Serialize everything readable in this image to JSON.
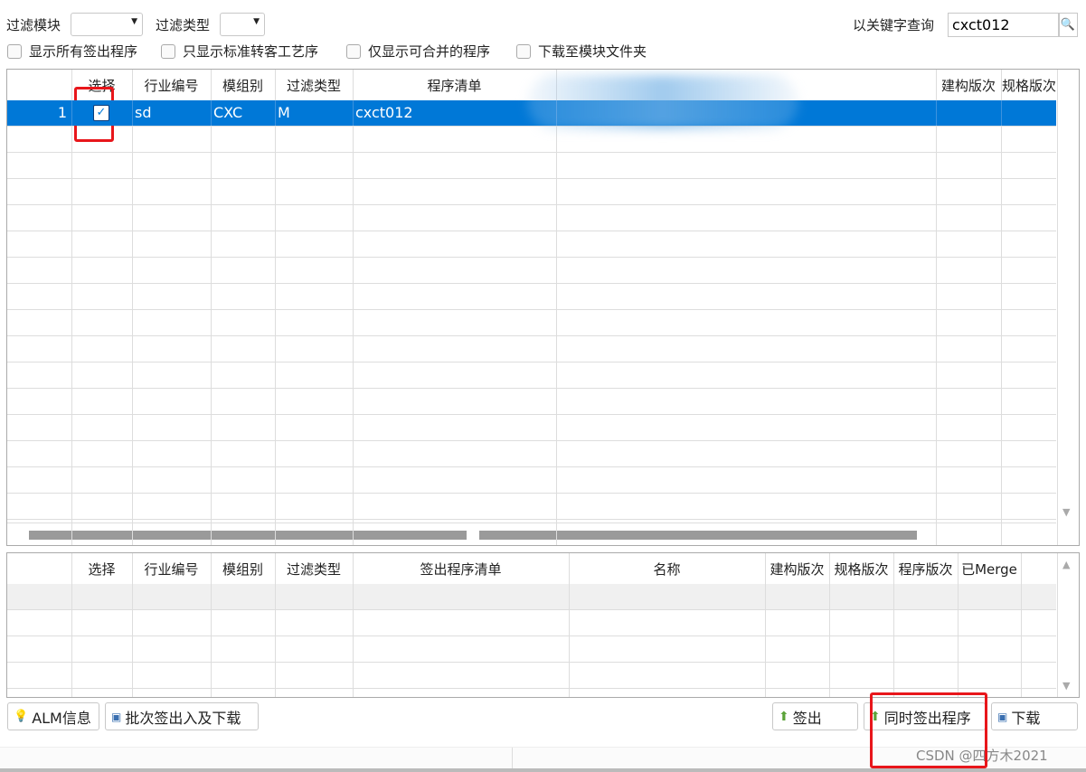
{
  "filters": {
    "module_label": "过滤模块",
    "module_value": "",
    "type_label": "过滤类型",
    "type_value": "",
    "search_label": "以关键字查询",
    "search_value": "cxct012"
  },
  "options": [
    {
      "label": "显示所有签出程序",
      "checked": false
    },
    {
      "label": "只显示标准转客工艺序",
      "checked": false
    },
    {
      "label": "仅显示可合并的程序",
      "checked": false
    },
    {
      "label": "下载至模块文件夹",
      "checked": false
    }
  ],
  "upper_grid": {
    "columns": [
      "",
      "选择",
      "行业编号",
      "模组别",
      "过滤类型",
      "程序清单",
      "",
      "建构版次",
      "规格版次"
    ],
    "rows": [
      {
        "no": "1",
        "selected": true,
        "industry": "sd",
        "module": "CXC",
        "filter_type": "M",
        "program": "cxct012"
      }
    ]
  },
  "lower_grid": {
    "columns": [
      "",
      "选择",
      "行业编号",
      "模组别",
      "过滤类型",
      "签出程序清单",
      "名称",
      "建构版次",
      "规格版次",
      "程序版次",
      "已Merge"
    ],
    "rows": []
  },
  "buttons": {
    "alm": "ALM信息",
    "batch": "批次签出入及下载",
    "checkout": "签出",
    "checkout_with": "同时签出程序",
    "download": "下载"
  },
  "watermark": "CSDN @四方木2021",
  "colors": {
    "selection": "#0078d7",
    "highlight": "#e8161b"
  }
}
